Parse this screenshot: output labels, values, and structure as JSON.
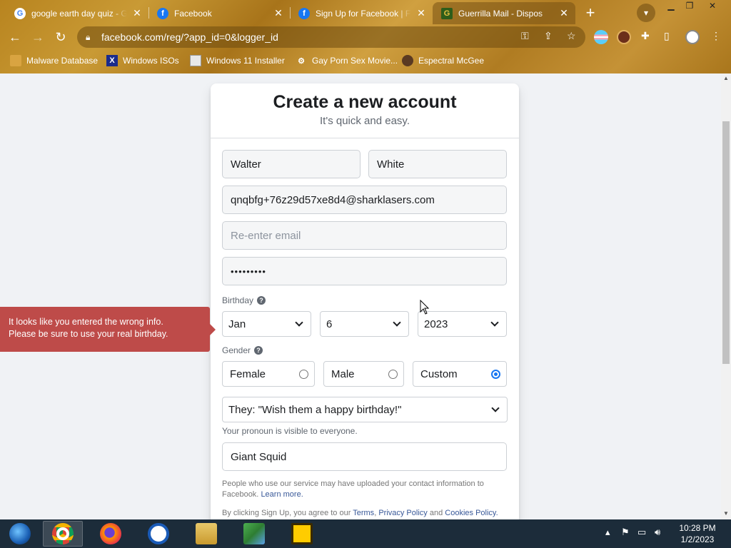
{
  "browser": {
    "tabs": [
      {
        "title": "google earth day quiz - Goo",
        "favicon": "google-icon",
        "active": false
      },
      {
        "title": "Facebook",
        "favicon": "facebook-icon",
        "active": false
      },
      {
        "title": "Sign Up for Facebook | Fa",
        "favicon": "facebook-icon",
        "active": false
      },
      {
        "title": "Guerrilla Mail - Dispos",
        "favicon": "guerrilla-mail-icon",
        "active": true
      }
    ],
    "url": "facebook.com/reg/?app_id=0&logger_id",
    "bookmarks": [
      {
        "label": "Malware Database",
        "icon": "folder-icon"
      },
      {
        "label": "Windows ISOs",
        "icon": "x-logo-icon"
      },
      {
        "label": "Windows 11 Installer",
        "icon": "image-icon"
      },
      {
        "label": "Gay Porn Sex Movie...",
        "icon": "gear-icon"
      },
      {
        "label": "Espectral McGee",
        "icon": "avatar-icon"
      }
    ]
  },
  "form": {
    "title": "Create a new account",
    "subtitle": "It's quick and easy.",
    "first_name": "Walter",
    "last_name": "White",
    "email": "qnqbfg+76z29d57xe8d4@sharklasers.com",
    "reenter_email_placeholder": "Re-enter email",
    "password_masked": "•••••••••",
    "birthday_label": "Birthday",
    "birthday_month": "Jan",
    "birthday_day": "6",
    "birthday_year": "2023",
    "gender_label": "Gender",
    "gender_options": [
      "Female",
      "Male",
      "Custom"
    ],
    "gender_selected": "Custom",
    "pronoun": "They: \"Wish them a happy birthday!\"",
    "pronoun_note": "Your pronoun is visible to everyone.",
    "custom_gender": "Giant Squid",
    "contact_notice": "People who use our service may have uploaded your contact information to Facebook.",
    "learn_more": "Learn more.",
    "terms_prefix": "By clicking Sign Up, you agree to our",
    "terms_link": "Terms",
    "privacy_link": "Privacy Policy",
    "and_text": "and",
    "cookies_link": "Cookies Policy."
  },
  "error": {
    "line1": "It looks like you entered the wrong info.",
    "line2": "Please be sure to use your real birthday."
  },
  "taskbar": {
    "time": "10:28 PM",
    "date": "1/2/2023",
    "apps": [
      "start-icon",
      "chrome-icon",
      "firefox-icon",
      "opera-icon",
      "file-explorer-icon",
      "network-icon",
      "dreamweaver-icon"
    ]
  },
  "colors": {
    "facebook_blue": "#1877f2",
    "error_red": "#be4b49",
    "chrome_theme": "#b8841f"
  }
}
